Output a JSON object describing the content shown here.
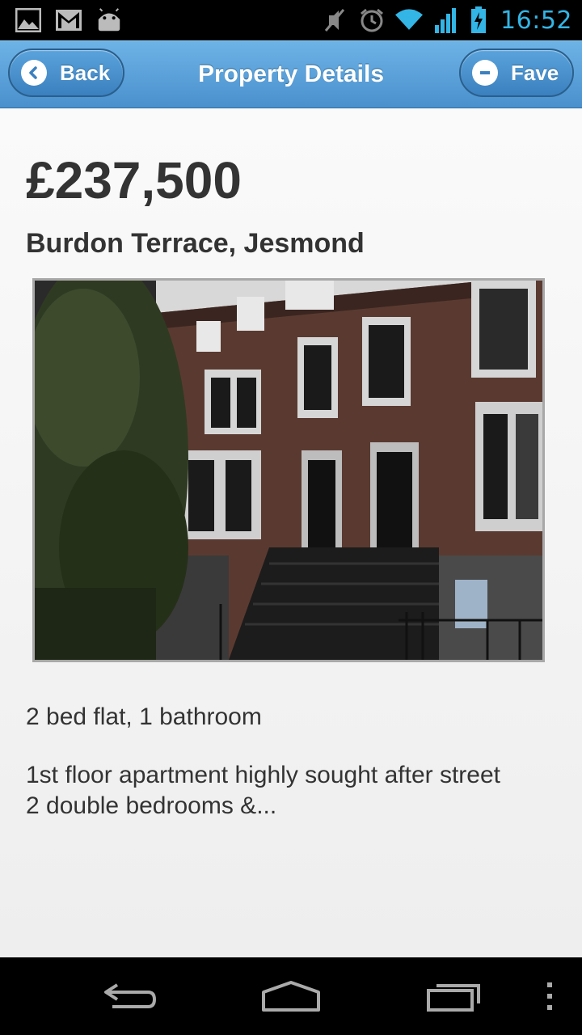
{
  "status_bar": {
    "time": "16:52",
    "icons": [
      "gallery-icon",
      "gmail-icon",
      "android-icon",
      "mute-icon",
      "alarm-icon",
      "wifi-icon",
      "signal-icon",
      "battery-charging-icon"
    ]
  },
  "header": {
    "title": "Property Details",
    "back_label": "Back",
    "fave_label": "Fave"
  },
  "property": {
    "price": "£237,500",
    "address": "Burdon Terrace, Jesmond",
    "summary": "2 bed flat, 1 bathroom",
    "description_line1": "1st floor apartment highly sought after street",
    "description_line2": "2 double bedrooms &..."
  },
  "nav_bar": {
    "icons": [
      "back-nav-icon",
      "home-nav-icon",
      "recent-apps-icon",
      "menu-icon"
    ]
  },
  "colors": {
    "header_blue": "#4a90cd",
    "status_blue": "#33b5e5",
    "text": "#333333"
  }
}
